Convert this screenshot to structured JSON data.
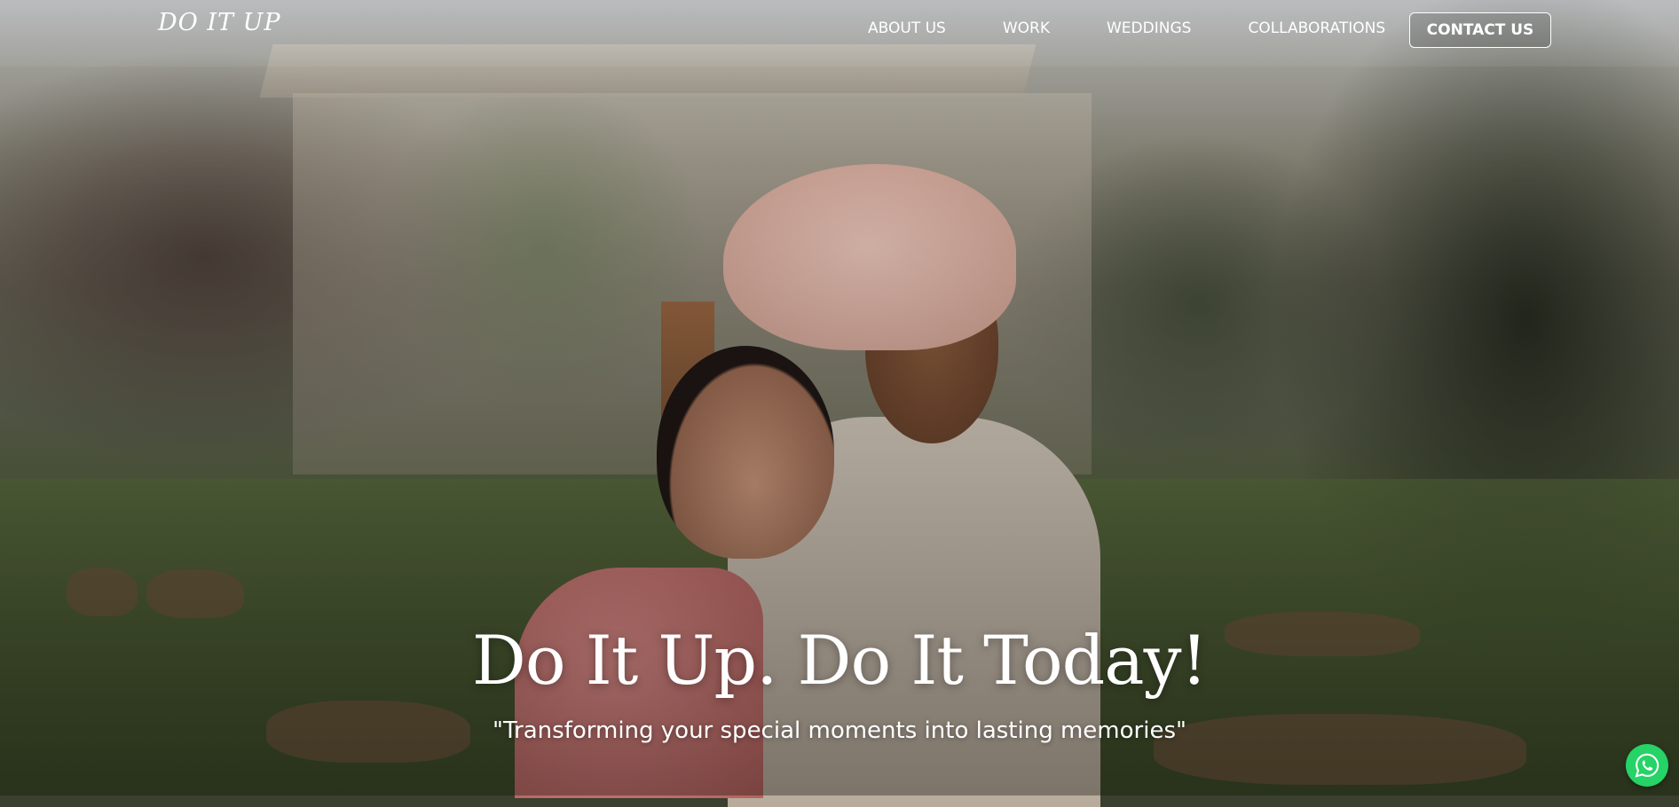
{
  "brand": {
    "logo_text": "DO IT UP"
  },
  "nav": {
    "items": [
      {
        "label": "ABOUT US"
      },
      {
        "label": "WORK"
      },
      {
        "label": "WEDDINGS"
      },
      {
        "label": "COLLABORATIONS"
      }
    ],
    "contact_label": "CONTACT US"
  },
  "hero": {
    "title": "Do It Up. Do It Today!",
    "tagline": "\"Transforming your special moments into lasting memories\""
  },
  "floating": {
    "whatsapp_icon": "whatsapp-icon",
    "color": "#25d366"
  }
}
